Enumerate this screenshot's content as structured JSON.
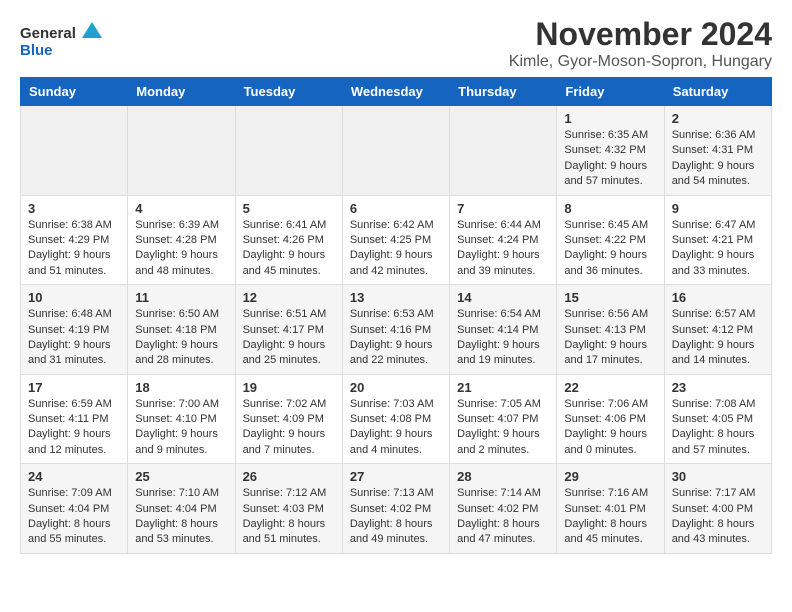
{
  "logo": {
    "line1": "General",
    "line2": "Blue"
  },
  "title": "November 2024",
  "subtitle": "Kimle, Gyor-Moson-Sopron, Hungary",
  "days_of_week": [
    "Sunday",
    "Monday",
    "Tuesday",
    "Wednesday",
    "Thursday",
    "Friday",
    "Saturday"
  ],
  "weeks": [
    [
      {
        "day": "",
        "detail": ""
      },
      {
        "day": "",
        "detail": ""
      },
      {
        "day": "",
        "detail": ""
      },
      {
        "day": "",
        "detail": ""
      },
      {
        "day": "",
        "detail": ""
      },
      {
        "day": "1",
        "detail": "Sunrise: 6:35 AM\nSunset: 4:32 PM\nDaylight: 9 hours and 57 minutes."
      },
      {
        "day": "2",
        "detail": "Sunrise: 6:36 AM\nSunset: 4:31 PM\nDaylight: 9 hours and 54 minutes."
      }
    ],
    [
      {
        "day": "3",
        "detail": "Sunrise: 6:38 AM\nSunset: 4:29 PM\nDaylight: 9 hours and 51 minutes."
      },
      {
        "day": "4",
        "detail": "Sunrise: 6:39 AM\nSunset: 4:28 PM\nDaylight: 9 hours and 48 minutes."
      },
      {
        "day": "5",
        "detail": "Sunrise: 6:41 AM\nSunset: 4:26 PM\nDaylight: 9 hours and 45 minutes."
      },
      {
        "day": "6",
        "detail": "Sunrise: 6:42 AM\nSunset: 4:25 PM\nDaylight: 9 hours and 42 minutes."
      },
      {
        "day": "7",
        "detail": "Sunrise: 6:44 AM\nSunset: 4:24 PM\nDaylight: 9 hours and 39 minutes."
      },
      {
        "day": "8",
        "detail": "Sunrise: 6:45 AM\nSunset: 4:22 PM\nDaylight: 9 hours and 36 minutes."
      },
      {
        "day": "9",
        "detail": "Sunrise: 6:47 AM\nSunset: 4:21 PM\nDaylight: 9 hours and 33 minutes."
      }
    ],
    [
      {
        "day": "10",
        "detail": "Sunrise: 6:48 AM\nSunset: 4:19 PM\nDaylight: 9 hours and 31 minutes."
      },
      {
        "day": "11",
        "detail": "Sunrise: 6:50 AM\nSunset: 4:18 PM\nDaylight: 9 hours and 28 minutes."
      },
      {
        "day": "12",
        "detail": "Sunrise: 6:51 AM\nSunset: 4:17 PM\nDaylight: 9 hours and 25 minutes."
      },
      {
        "day": "13",
        "detail": "Sunrise: 6:53 AM\nSunset: 4:16 PM\nDaylight: 9 hours and 22 minutes."
      },
      {
        "day": "14",
        "detail": "Sunrise: 6:54 AM\nSunset: 4:14 PM\nDaylight: 9 hours and 19 minutes."
      },
      {
        "day": "15",
        "detail": "Sunrise: 6:56 AM\nSunset: 4:13 PM\nDaylight: 9 hours and 17 minutes."
      },
      {
        "day": "16",
        "detail": "Sunrise: 6:57 AM\nSunset: 4:12 PM\nDaylight: 9 hours and 14 minutes."
      }
    ],
    [
      {
        "day": "17",
        "detail": "Sunrise: 6:59 AM\nSunset: 4:11 PM\nDaylight: 9 hours and 12 minutes."
      },
      {
        "day": "18",
        "detail": "Sunrise: 7:00 AM\nSunset: 4:10 PM\nDaylight: 9 hours and 9 minutes."
      },
      {
        "day": "19",
        "detail": "Sunrise: 7:02 AM\nSunset: 4:09 PM\nDaylight: 9 hours and 7 minutes."
      },
      {
        "day": "20",
        "detail": "Sunrise: 7:03 AM\nSunset: 4:08 PM\nDaylight: 9 hours and 4 minutes."
      },
      {
        "day": "21",
        "detail": "Sunrise: 7:05 AM\nSunset: 4:07 PM\nDaylight: 9 hours and 2 minutes."
      },
      {
        "day": "22",
        "detail": "Sunrise: 7:06 AM\nSunset: 4:06 PM\nDaylight: 9 hours and 0 minutes."
      },
      {
        "day": "23",
        "detail": "Sunrise: 7:08 AM\nSunset: 4:05 PM\nDaylight: 8 hours and 57 minutes."
      }
    ],
    [
      {
        "day": "24",
        "detail": "Sunrise: 7:09 AM\nSunset: 4:04 PM\nDaylight: 8 hours and 55 minutes."
      },
      {
        "day": "25",
        "detail": "Sunrise: 7:10 AM\nSunset: 4:04 PM\nDaylight: 8 hours and 53 minutes."
      },
      {
        "day": "26",
        "detail": "Sunrise: 7:12 AM\nSunset: 4:03 PM\nDaylight: 8 hours and 51 minutes."
      },
      {
        "day": "27",
        "detail": "Sunrise: 7:13 AM\nSunset: 4:02 PM\nDaylight: 8 hours and 49 minutes."
      },
      {
        "day": "28",
        "detail": "Sunrise: 7:14 AM\nSunset: 4:02 PM\nDaylight: 8 hours and 47 minutes."
      },
      {
        "day": "29",
        "detail": "Sunrise: 7:16 AM\nSunset: 4:01 PM\nDaylight: 8 hours and 45 minutes."
      },
      {
        "day": "30",
        "detail": "Sunrise: 7:17 AM\nSunset: 4:00 PM\nDaylight: 8 hours and 43 minutes."
      }
    ]
  ]
}
